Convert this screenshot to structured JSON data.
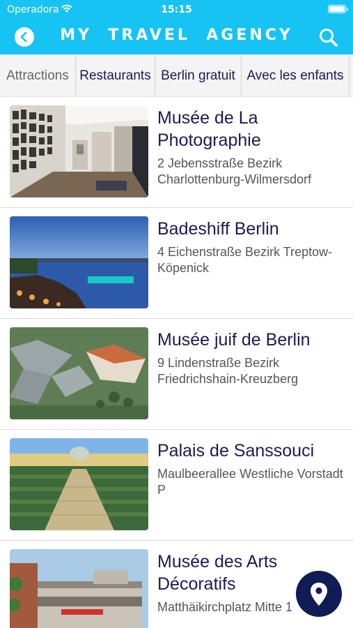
{
  "status_bar": {
    "carrier": "Operadora",
    "time": "15:15"
  },
  "header": {
    "title": "MY  TRAVEL  AGENCY"
  },
  "tabs": [
    {
      "label": "Attractions",
      "active": true
    },
    {
      "label": "Restaurants",
      "active": false
    },
    {
      "label": "Berlin gratuit",
      "active": false
    },
    {
      "label": "Avec les enfants",
      "active": false
    }
  ],
  "places": [
    {
      "title": "Musée de La Photographie",
      "address": "2 Jebensstraße Bezirk Charlottenburg-Wilmersdorf",
      "image": "gallery-interior-photo"
    },
    {
      "title": "Badeshiff Berlin",
      "address": "4 Eichenstraße Bezirk Treptow-Köpenick",
      "image": "river-pool-dusk-photo"
    },
    {
      "title": "Musée juif de Berlin",
      "address": "9 Lindenstraße Bezirk Friedrichshain-Kreuzberg",
      "image": "aerial-museum-photo"
    },
    {
      "title": "Palais de Sanssouci",
      "address": "Maulbeerallee Westliche Vorstadt P",
      "image": "palace-terraces-photo"
    },
    {
      "title": "Musée des Arts Décoratifs",
      "address": "Matthäikirchplatz Mitte 1",
      "image": "modern-building-photo"
    }
  ],
  "colors": {
    "brand": "#17c3f2",
    "title_text": "#1c1a52",
    "fab": "#0f1c55"
  },
  "icons": {
    "back": "chevron-left-icon",
    "search": "search-icon",
    "map": "map-pin-icon"
  }
}
